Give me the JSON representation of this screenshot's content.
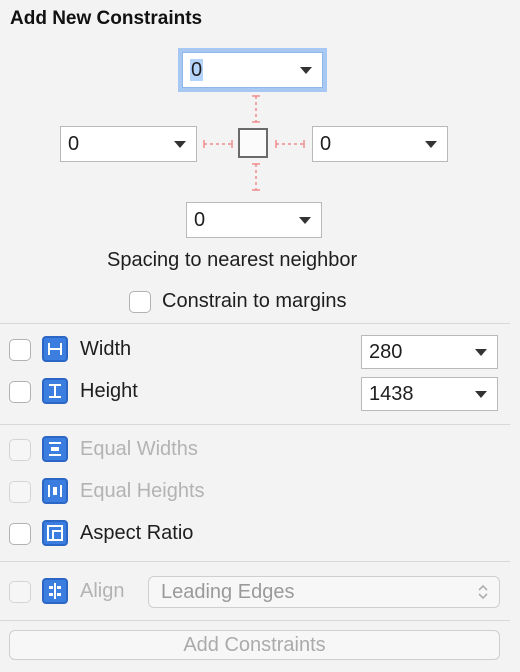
{
  "title": "Add New Constraints",
  "spacing": {
    "top": "0",
    "left": "0",
    "right": "0",
    "bottom": "0",
    "label": "Spacing to nearest neighbor"
  },
  "constrain_to_margins": {
    "label": "Constrain to margins",
    "checked": false
  },
  "size": {
    "width": {
      "label": "Width",
      "value": "280",
      "checked": false,
      "icon": "width-icon"
    },
    "height": {
      "label": "Height",
      "value": "1438",
      "checked": false,
      "icon": "height-icon"
    }
  },
  "equal": {
    "widths": {
      "label": "Equal Widths",
      "enabled": false,
      "icon": "equal-widths-icon"
    },
    "heights": {
      "label": "Equal Heights",
      "enabled": false,
      "icon": "equal-heights-icon"
    },
    "aspect": {
      "label": "Aspect Ratio",
      "enabled": true,
      "icon": "aspect-ratio-icon"
    }
  },
  "align": {
    "label": "Align",
    "value": "Leading Edges",
    "enabled": false,
    "icon": "align-icon"
  },
  "add_button": {
    "label": "Add Constraints",
    "enabled": false
  },
  "colors": {
    "accent": "#3b7ee0",
    "focus_ring": "#a6c8f2",
    "guide": "#f08c8c"
  }
}
